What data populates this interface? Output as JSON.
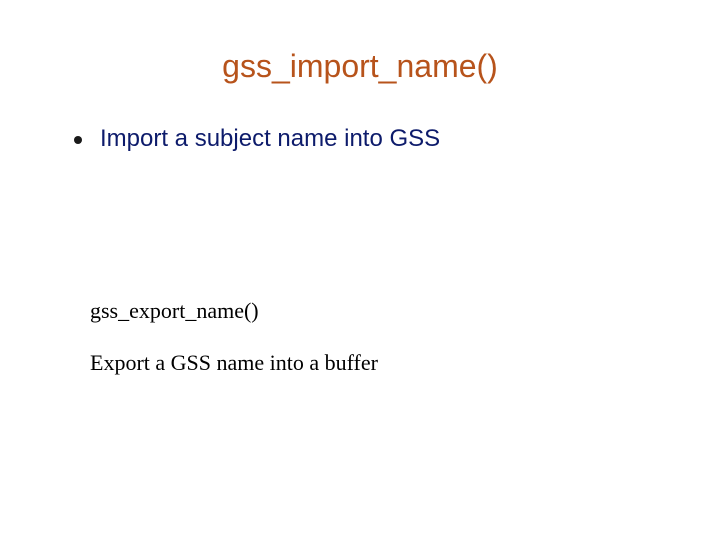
{
  "title": "gss_import_name()",
  "bullet": {
    "text": "Import a subject name into GSS"
  },
  "sub": {
    "heading": "gss_export_name()",
    "text": "Export a GSS name into a buffer"
  }
}
